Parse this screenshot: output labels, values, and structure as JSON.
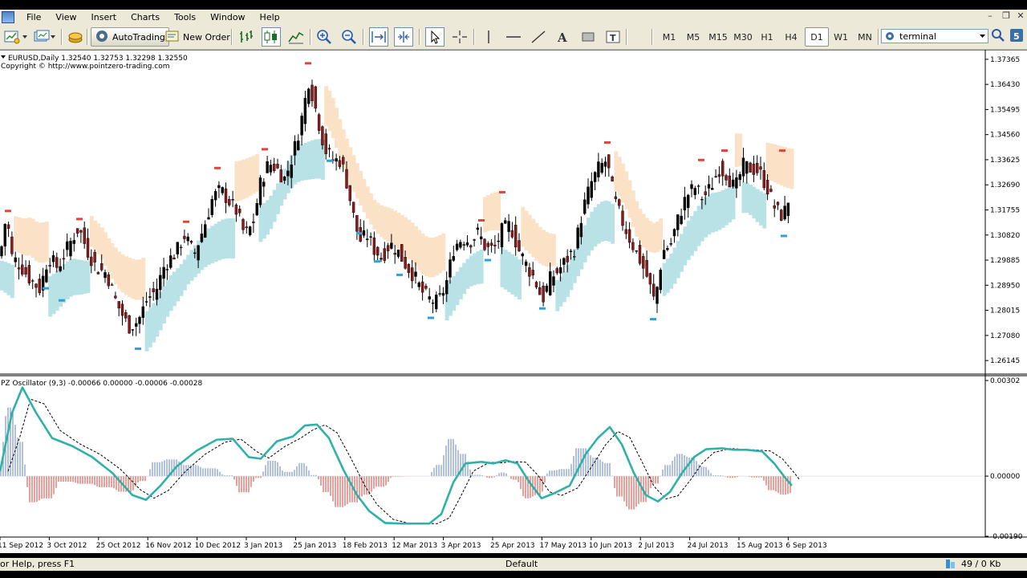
{
  "menu": [
    "File",
    "View",
    "Insert",
    "Charts",
    "Tools",
    "Window",
    "Help"
  ],
  "toolbar": {
    "autotrading_label": "AutoTrading",
    "new_order_label": "New Order",
    "timeframes": [
      "M1",
      "M5",
      "M15",
      "M30",
      "H1",
      "H4",
      "D1",
      "W1",
      "MN"
    ],
    "active_timeframe": "D1",
    "search_value": "terminal",
    "icons": [
      "new-chart-icon",
      "profiles-icon",
      "market-watch-icon",
      "autotrading-icon",
      "new-order-icon",
      "bar-chart-icon",
      "candlestick-icon",
      "line-chart-icon",
      "zoom-in-icon",
      "zoom-out-icon",
      "autoscroll-icon",
      "chart-shift-icon",
      "cursor-icon",
      "crosshair-icon",
      "vertical-line-icon",
      "horizontal-line-icon",
      "trendline-icon",
      "text-icon",
      "rectangle-icon",
      "text-label-icon",
      "search-icon",
      "community-icon"
    ]
  },
  "main_chart": {
    "header": "EURUSD,Daily  1.32540  1.32753  1.32298  1.32550",
    "copyright": "Copyright © http://www.pointzero-trading.com",
    "price_labels": [
      "1.37365",
      "1.36430",
      "1.35495",
      "1.34560",
      "1.33625",
      "1.32690",
      "1.31755",
      "1.30820",
      "1.29885",
      "1.28950",
      "1.28015",
      "1.27080",
      "1.26145"
    ],
    "price_min": 1.257,
    "price_max": 1.376
  },
  "oscillator": {
    "header": "PZ Oscillator (9,3) -0.00066 0.00000 -0.00006 -0.00028",
    "labels": [
      "0.00302",
      "0.00000",
      "-0.00190"
    ]
  },
  "date_labels": [
    "11 Sep 2012",
    "3 Oct 2012",
    "25 Oct 2012",
    "16 Nov 2012",
    "10 Dec 2012",
    "3 Jan 2013",
    "25 Jan 2013",
    "18 Feb 2013",
    "12 Mar 2013",
    "3 Apr 2013",
    "25 Apr 2013",
    "17 May 2013",
    "10 Jun 2013",
    "2 Jul 2013",
    "24 Jul 2013",
    "15 Aug 2013",
    "6 Sep 2013"
  ],
  "chart_data": {
    "type": "candlestick",
    "symbol": "EURUSD",
    "timeframe": "Daily",
    "close_path": [
      [
        0,
        1.3
      ],
      [
        8,
        1.316
      ],
      [
        15,
        1.3
      ],
      [
        25,
        1.297
      ],
      [
        37,
        1.292
      ],
      [
        50,
        1.288
      ],
      [
        60,
        1.3
      ],
      [
        72,
        1.296
      ],
      [
        85,
        1.304
      ],
      [
        98,
        1.311
      ],
      [
        108,
        1.303
      ],
      [
        120,
        1.296
      ],
      [
        133,
        1.294
      ],
      [
        145,
        1.283
      ],
      [
        160,
        1.274
      ],
      [
        172,
        1.276
      ],
      [
        183,
        1.284
      ],
      [
        195,
        1.288
      ],
      [
        205,
        1.297
      ],
      [
        220,
        1.302
      ],
      [
        230,
        1.308
      ],
      [
        242,
        1.301
      ],
      [
        255,
        1.312
      ],
      [
        265,
        1.322
      ],
      [
        275,
        1.325
      ],
      [
        285,
        1.321
      ],
      [
        295,
        1.317
      ],
      [
        305,
        1.308
      ],
      [
        315,
        1.312
      ],
      [
        325,
        1.328
      ],
      [
        335,
        1.335
      ],
      [
        345,
        1.333
      ],
      [
        355,
        1.329
      ],
      [
        365,
        1.338
      ],
      [
        375,
        1.35
      ],
      [
        385,
        1.366
      ],
      [
        395,
        1.353
      ],
      [
        405,
        1.34
      ],
      [
        415,
        1.336
      ],
      [
        425,
        1.336
      ],
      [
        432,
        1.328
      ],
      [
        440,
        1.316
      ],
      [
        448,
        1.306
      ],
      [
        458,
        1.308
      ],
      [
        466,
        1.303
      ],
      [
        476,
        1.3
      ],
      [
        486,
        1.305
      ],
      [
        496,
        1.302
      ],
      [
        506,
        1.297
      ],
      [
        516,
        1.293
      ],
      [
        526,
        1.287
      ],
      [
        536,
        1.284
      ],
      [
        546,
        1.283
      ],
      [
        556,
        1.29
      ],
      [
        566,
        1.304
      ],
      [
        576,
        1.307
      ],
      [
        586,
        1.306
      ],
      [
        596,
        1.309
      ],
      [
        606,
        1.303
      ],
      [
        616,
        1.303
      ],
      [
        626,
        1.31
      ],
      [
        636,
        1.312
      ],
      [
        646,
        1.303
      ],
      [
        656,
        1.297
      ],
      [
        666,
        1.292
      ],
      [
        676,
        1.284
      ],
      [
        686,
        1.292
      ],
      [
        696,
        1.295
      ],
      [
        706,
        1.299
      ],
      [
        716,
        1.303
      ],
      [
        726,
        1.317
      ],
      [
        736,
        1.327
      ],
      [
        746,
        1.333
      ],
      [
        756,
        1.336
      ],
      [
        766,
        1.321
      ],
      [
        776,
        1.313
      ],
      [
        786,
        1.306
      ],
      [
        796,
        1.3
      ],
      [
        806,
        1.293
      ],
      [
        816,
        1.283
      ],
      [
        826,
        1.302
      ],
      [
        836,
        1.305
      ],
      [
        846,
        1.315
      ],
      [
        856,
        1.323
      ],
      [
        866,
        1.326
      ],
      [
        876,
        1.322
      ],
      [
        886,
        1.326
      ],
      [
        896,
        1.333
      ],
      [
        906,
        1.331
      ],
      [
        916,
        1.325
      ],
      [
        926,
        1.334
      ],
      [
        936,
        1.333
      ],
      [
        946,
        1.332
      ],
      [
        956,
        1.326
      ],
      [
        966,
        1.318
      ],
      [
        976,
        1.315
      ],
      [
        986,
        1.325
      ]
    ],
    "swing_highs": [
      [
        10,
        1.317
      ],
      [
        99,
        1.314
      ],
      [
        232,
        1.313
      ],
      [
        271,
        1.333
      ],
      [
        330,
        1.34
      ],
      [
        384,
        1.372
      ],
      [
        626,
        1.324
      ],
      [
        600,
        1.3135
      ],
      [
        757,
        1.3425
      ],
      [
        874,
        1.336
      ],
      [
        903,
        1.3395
      ],
      [
        975,
        1.3395
      ]
    ],
    "swing_lows": [
      [
        57,
        1.2885
      ],
      [
        77,
        1.284
      ],
      [
        172,
        1.266
      ],
      [
        411,
        1.336
      ],
      [
        448,
        1.309
      ],
      [
        470,
        1.2985
      ],
      [
        498,
        1.2935
      ],
      [
        537,
        1.2775
      ],
      [
        608,
        1.299
      ],
      [
        676,
        1.281
      ],
      [
        814,
        1.277
      ],
      [
        977,
        1.308
      ]
    ],
    "oscillator_line": [
      [
        0,
        0.00015
      ],
      [
        15,
        0.002
      ],
      [
        28,
        0.0028
      ],
      [
        45,
        0.002
      ],
      [
        65,
        0.0012
      ],
      [
        90,
        0.00095
      ],
      [
        115,
        0.0006
      ],
      [
        140,
        0.0001
      ],
      [
        165,
        -0.0006
      ],
      [
        182,
        -0.00075
      ],
      [
        200,
        -0.0003
      ],
      [
        220,
        0.0003
      ],
      [
        245,
        0.0008
      ],
      [
        270,
        0.00115
      ],
      [
        290,
        0.00118
      ],
      [
        310,
        0.0006
      ],
      [
        325,
        0.00055
      ],
      [
        345,
        0.0011
      ],
      [
        365,
        0.00125
      ],
      [
        380,
        0.0016
      ],
      [
        395,
        0.00163
      ],
      [
        410,
        0.0012
      ],
      [
        428,
        0.0002
      ],
      [
        445,
        -0.0006
      ],
      [
        460,
        -0.0011
      ],
      [
        480,
        -0.00148
      ],
      [
        500,
        -0.0015
      ],
      [
        520,
        -0.0015
      ],
      [
        535,
        -0.0015
      ],
      [
        550,
        -0.0012
      ],
      [
        565,
        -0.0002
      ],
      [
        580,
        0.0004
      ],
      [
        600,
        0.00045
      ],
      [
        615,
        0.0004
      ],
      [
        630,
        0.0005
      ],
      [
        645,
        0.0004
      ],
      [
        660,
        -0.0002
      ],
      [
        675,
        -0.0007
      ],
      [
        690,
        -0.00055
      ],
      [
        710,
        -0.0003
      ],
      [
        730,
        0.0007
      ],
      [
        745,
        0.0012
      ],
      [
        760,
        0.00155
      ],
      [
        775,
        0.001
      ],
      [
        790,
        0.0001
      ],
      [
        805,
        -0.0006
      ],
      [
        820,
        -0.0008
      ],
      [
        835,
        -0.0005
      ],
      [
        850,
        0.0001
      ],
      [
        865,
        0.0006
      ],
      [
        880,
        0.00085
      ],
      [
        900,
        0.00088
      ],
      [
        915,
        0.00083
      ],
      [
        930,
        0.00083
      ],
      [
        950,
        0.00078
      ],
      [
        965,
        0.0004
      ],
      [
        980,
        -0.0001
      ],
      [
        987,
        -0.0003
      ]
    ]
  }
}
